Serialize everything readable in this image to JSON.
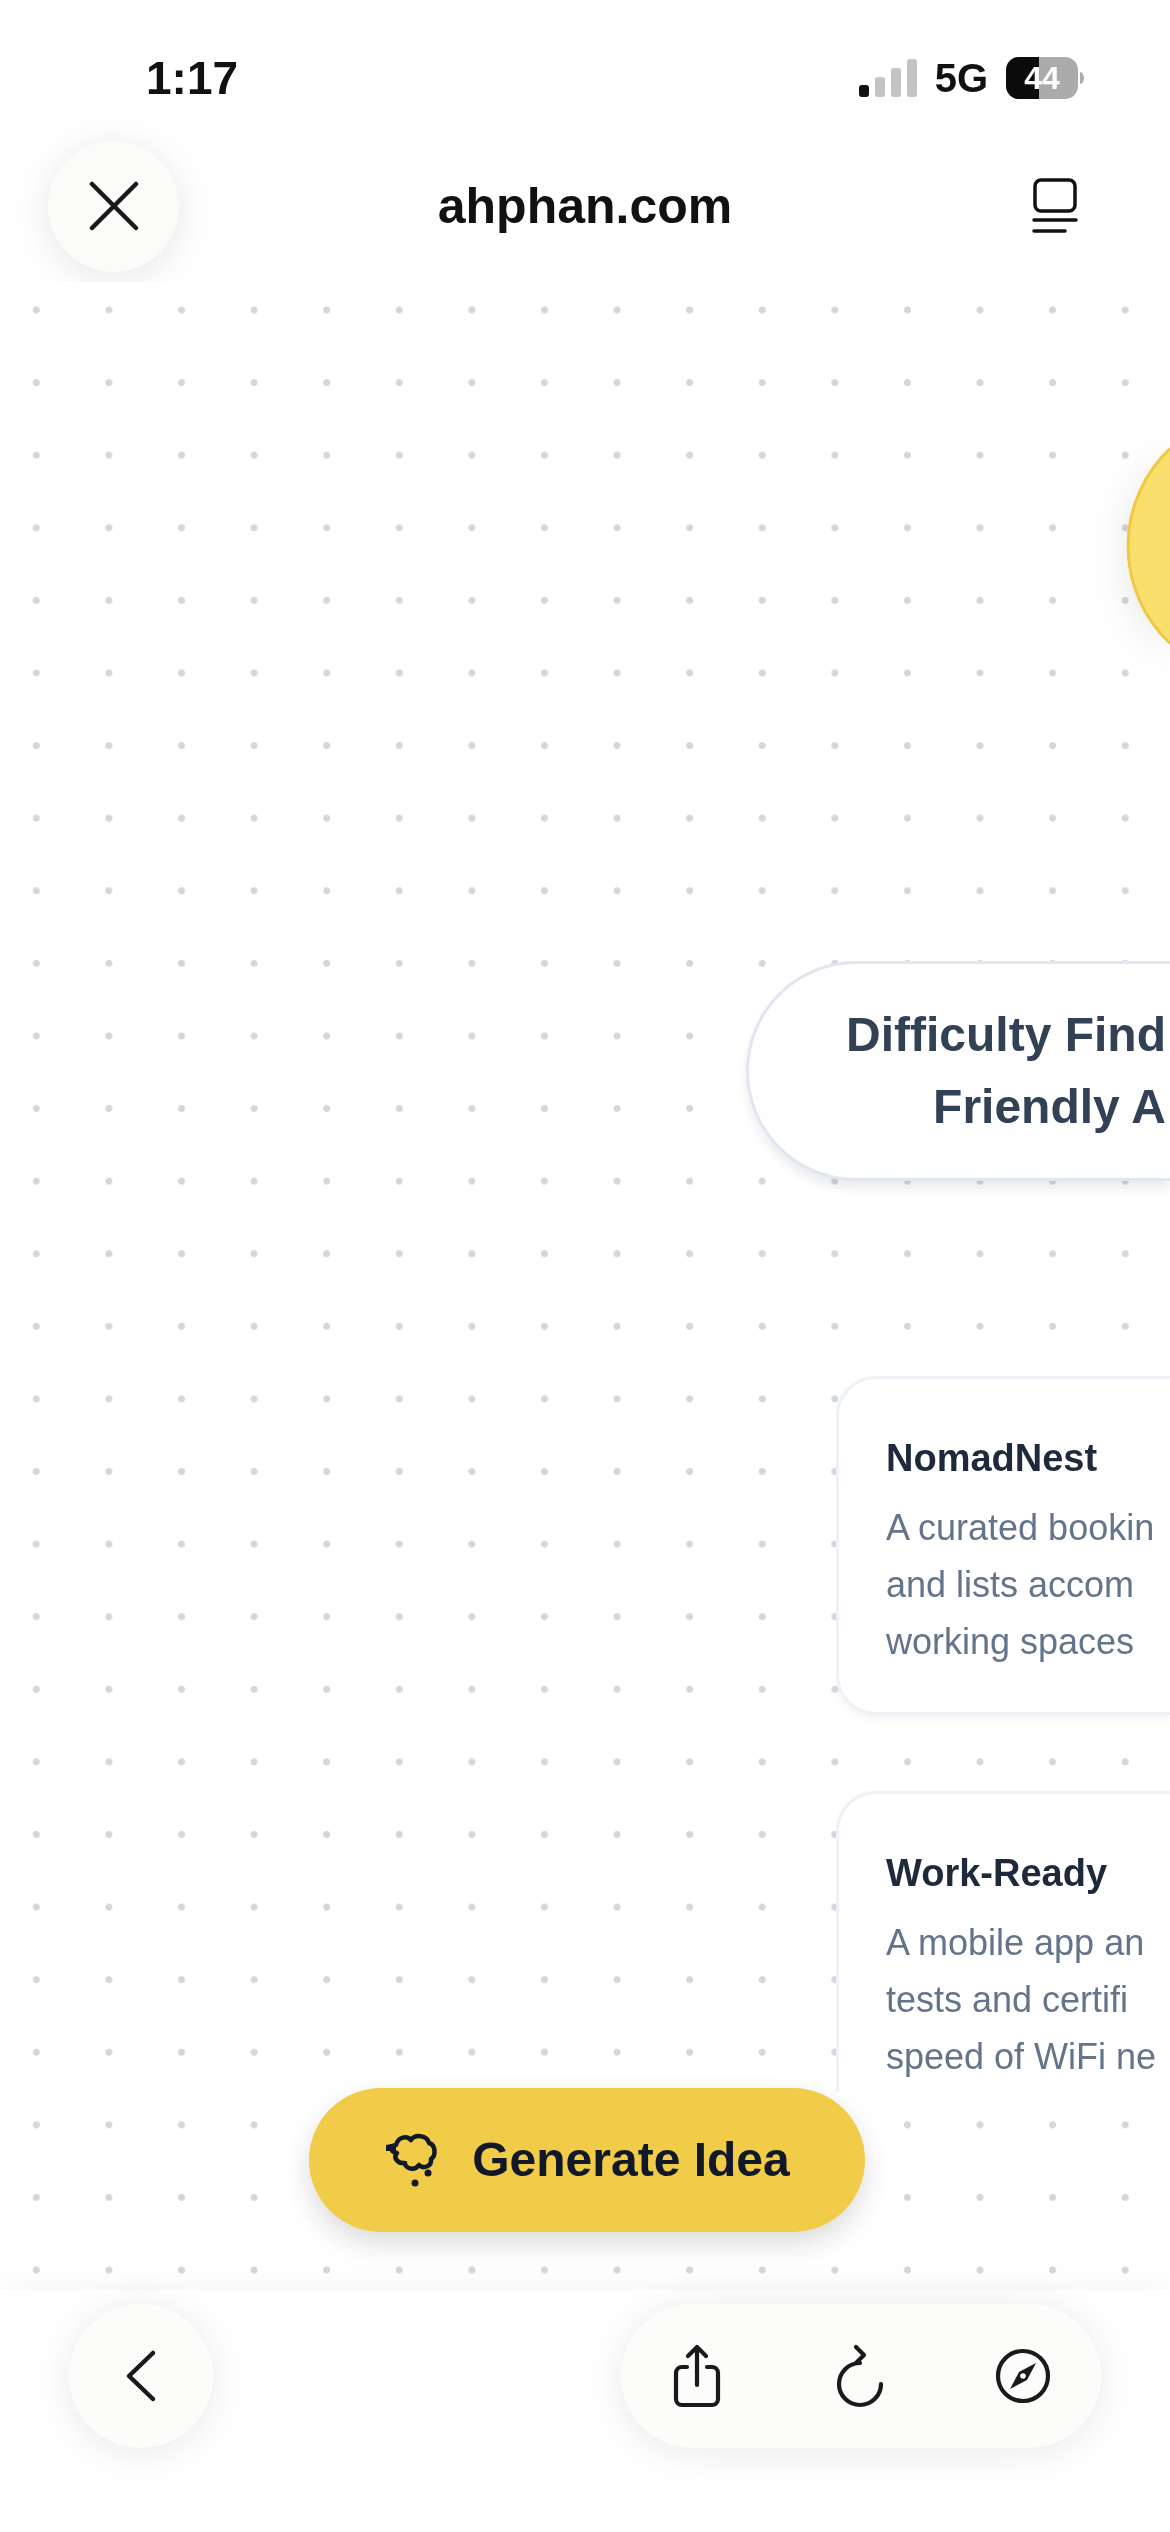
{
  "status_bar": {
    "time": "1:17",
    "network": "5G",
    "battery": "44"
  },
  "browser_header": {
    "title": "ahphan.com"
  },
  "canvas": {
    "topic_node": {
      "label_lines": [
        "Difficulty Find",
        "Friendly A"
      ]
    },
    "idea_cards": [
      {
        "title": "NomadNest",
        "description_lines": [
          "A curated bookin",
          "and lists accom",
          "working spaces"
        ]
      },
      {
        "title": "Work-Ready",
        "description_lines": [
          "A mobile app an",
          "tests and certifi",
          "speed of WiFi ne"
        ]
      }
    ],
    "generate_button": {
      "label": "Generate Idea"
    }
  }
}
